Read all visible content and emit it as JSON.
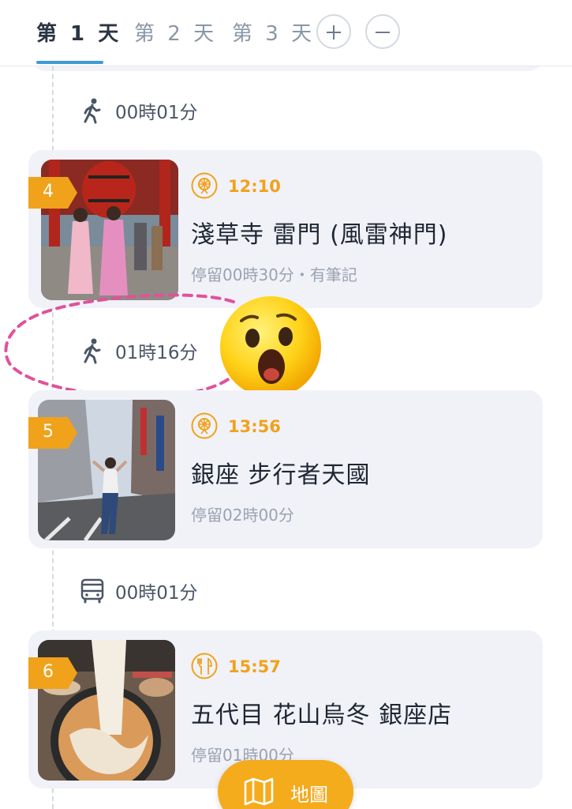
{
  "tabs": [
    {
      "label": "第 1 天",
      "active": true
    },
    {
      "label": "第 2 天",
      "active": false
    },
    {
      "label": "第 3 天",
      "active": false
    }
  ],
  "tab_buttons": {
    "add_icon": "plus-icon",
    "remove_icon": "minus-icon"
  },
  "transits": [
    {
      "mode": "walk-icon",
      "duration": "00時01分"
    },
    {
      "mode": "walk-icon",
      "duration": "01時16分"
    },
    {
      "mode": "bus-icon",
      "duration": "00時01分"
    }
  ],
  "stops": [
    {
      "number": "4",
      "category_icon": "ferris-wheel-icon",
      "time": "12:10",
      "name": "淺草寺 雷門 (風雷神門)",
      "stay": "停留00時30分・有筆記"
    },
    {
      "number": "5",
      "category_icon": "ferris-wheel-icon",
      "time": "13:56",
      "name": "銀座 步行者天國",
      "stay": "停留02時00分"
    },
    {
      "number": "6",
      "category_icon": "fork-knife-icon",
      "time": "15:57",
      "name": "五代目 花山烏冬 銀座店",
      "stay": "停留01時00分"
    }
  ],
  "map_button": {
    "label": "地圖",
    "icon": "map-icon"
  },
  "colors": {
    "accent": "#f0a21b",
    "tab_underline": "#3d9bd6",
    "annotation": "#e0529b"
  }
}
